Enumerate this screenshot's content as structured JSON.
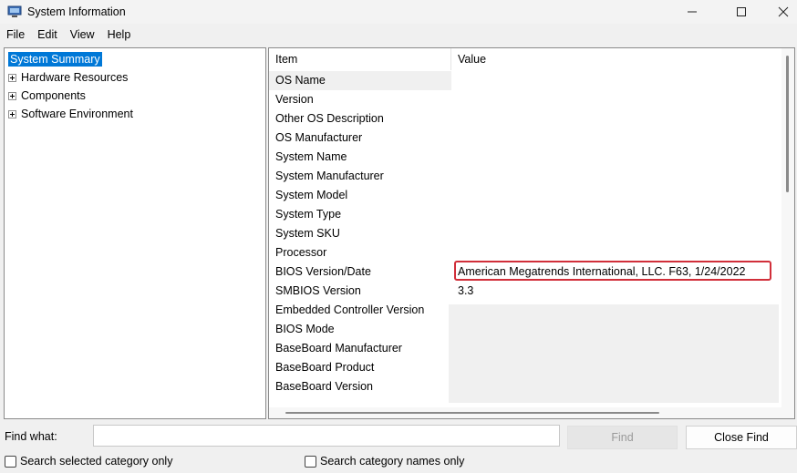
{
  "window": {
    "title": "System Information",
    "icon": "system-information-icon",
    "controls": [
      "minimize-icon",
      "maximize-icon",
      "close-icon"
    ]
  },
  "menu": [
    "File",
    "Edit",
    "View",
    "Help"
  ],
  "tree": {
    "selected": "System Summary",
    "items": [
      {
        "label": "System Summary",
        "expandable": false
      },
      {
        "label": "Hardware Resources",
        "expandable": true
      },
      {
        "label": "Components",
        "expandable": true
      },
      {
        "label": "Software Environment",
        "expandable": true
      }
    ]
  },
  "table": {
    "columns": [
      "Item",
      "Value"
    ],
    "rows": [
      {
        "item": "OS Name",
        "value": ""
      },
      {
        "item": "Version",
        "value": ""
      },
      {
        "item": "Other OS Description",
        "value": ""
      },
      {
        "item": "OS Manufacturer",
        "value": ""
      },
      {
        "item": "System Name",
        "value": ""
      },
      {
        "item": "System Manufacturer",
        "value": ""
      },
      {
        "item": "System Model",
        "value": ""
      },
      {
        "item": "System Type",
        "value": ""
      },
      {
        "item": "System SKU",
        "value": ""
      },
      {
        "item": "Processor",
        "value": ""
      },
      {
        "item": "BIOS Version/Date",
        "value": "American Megatrends International, LLC. F63, 1/24/2022"
      },
      {
        "item": "SMBIOS Version",
        "value": "3.3"
      },
      {
        "item": "Embedded Controller Version",
        "value": ""
      },
      {
        "item": "BIOS Mode",
        "value": ""
      },
      {
        "item": "BaseBoard Manufacturer",
        "value": ""
      },
      {
        "item": "BaseBoard Product",
        "value": ""
      },
      {
        "item": "BaseBoard Version",
        "value": ""
      }
    ],
    "highlight_color": "#d12f3a"
  },
  "find": {
    "label": "Find what:",
    "value": "",
    "find_button": "Find",
    "close_button": "Close Find",
    "option_selected_category": "Search selected category only",
    "option_category_names": "Search category names only"
  }
}
